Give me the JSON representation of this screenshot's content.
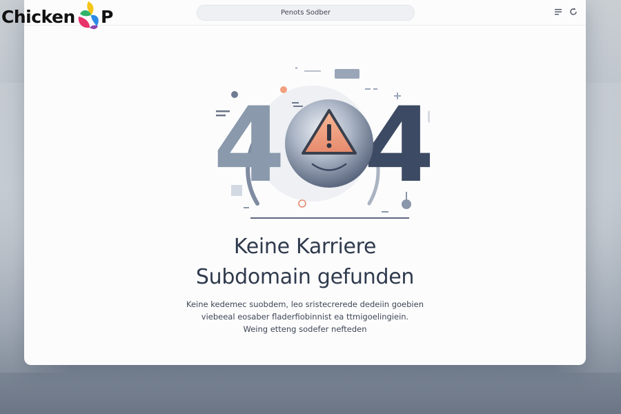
{
  "logo": {
    "text_left": "Chicken",
    "text_right": "P"
  },
  "browser": {
    "address": "Penots Sodber",
    "icons": [
      "menu-icon",
      "refresh-icon"
    ]
  },
  "illustration": {
    "digit_left": "4",
    "digit_right": "4",
    "center_icon": "warning-icon",
    "colors": {
      "digit_left": "#8a99ab",
      "digit_right": "#3d4a63",
      "warning": "#f0a282",
      "sphere": "#7c89a0"
    }
  },
  "main": {
    "headline_line1": "Keine Karriere",
    "headline_line2": "Subdomain gefunden",
    "paragraph": [
      "Keine kedemec suobdem, leo sristecrerede dedeiin goebien",
      "viebeeal eosaber fladerfiobinnist ea ttmigoelingiein.",
      "Weing etteng sodefer nefteden"
    ]
  }
}
